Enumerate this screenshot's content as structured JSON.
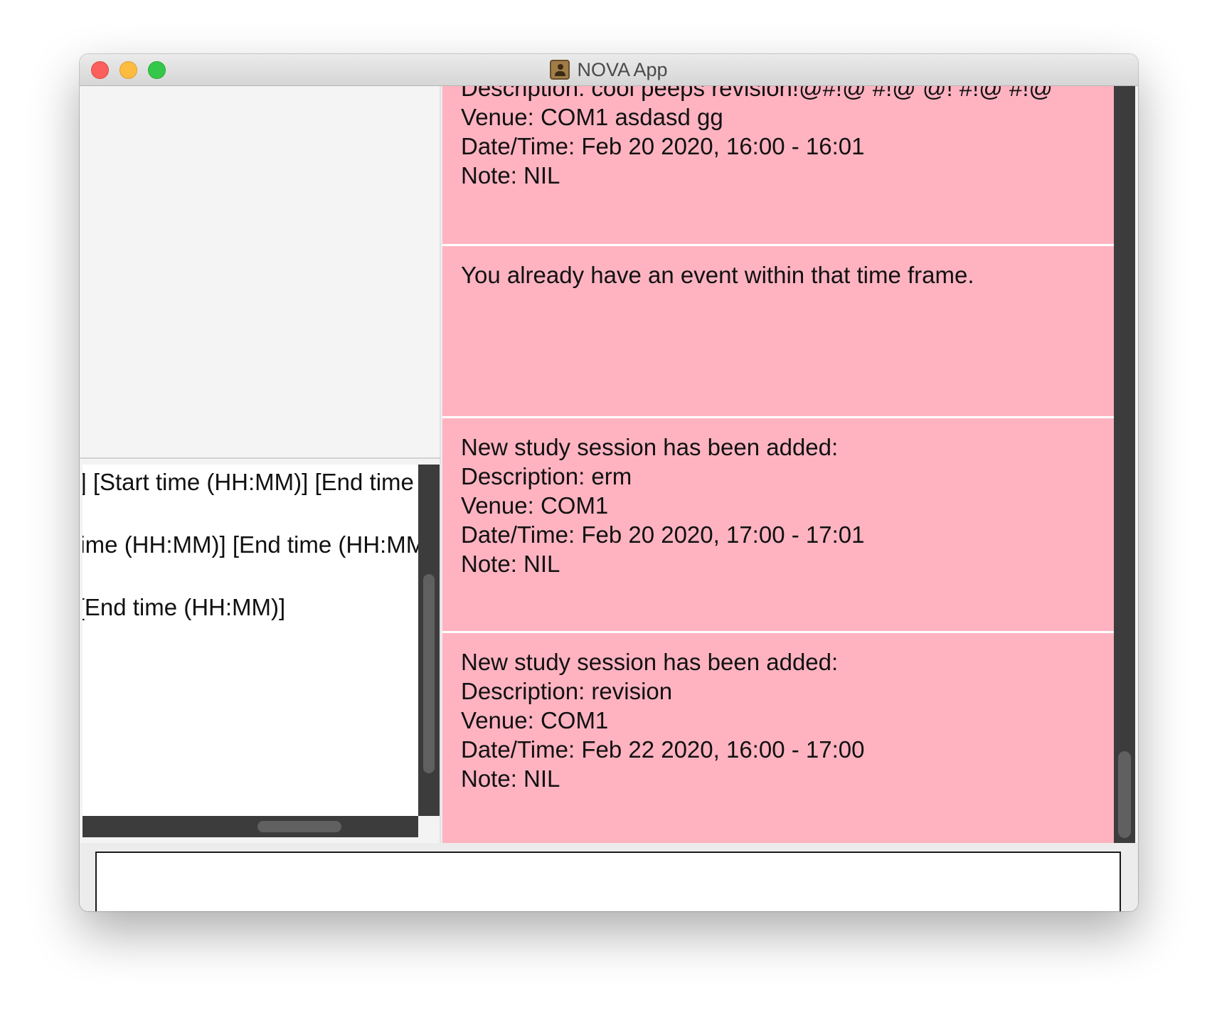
{
  "window": {
    "title": "NOVA App",
    "icon": "address-book-icon"
  },
  "command_history": {
    "lines": [
      "M)] [Start time (HH:MM)] [End time (HH:MM)]",
      "D)] [Start time (HH:MM)] [End time (HH:MM)]",
      "[Start time (HH:MM)] [End time (HH:MM)]"
    ]
  },
  "results": [
    {
      "lines": [
        "Description: cool peeps revision!@#!@ #!@ @! #!@ #!@",
        "Venue: COM1 asdasd gg",
        "Date/Time: Feb 20 2020, 16:00 - 16:01",
        "Note: NIL"
      ]
    },
    {
      "lines": [
        "You already have an event within that time frame."
      ]
    },
    {
      "lines": [
        "New study session has been added:",
        "Description: erm",
        "Venue: COM1",
        "Date/Time: Feb 20 2020, 17:00 - 17:01",
        "Note: NIL"
      ]
    },
    {
      "lines": [
        "New study session has been added:",
        "Description: revision",
        "Venue: COM1",
        "Date/Time: Feb 22 2020, 16:00 - 17:00",
        "Note: NIL"
      ]
    }
  ],
  "command_input": {
    "value": "",
    "placeholder": ""
  },
  "colors": {
    "result_card_background": "#ffb3c1",
    "scrollbar_track": "#3c3c3c",
    "scrollbar_thumb": "#606060"
  }
}
